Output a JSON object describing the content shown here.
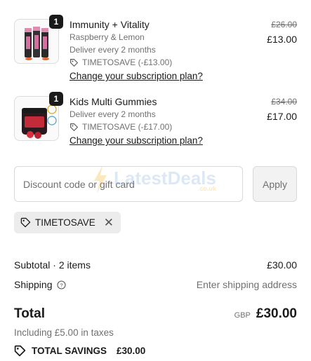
{
  "items": [
    {
      "qty": "1",
      "name": "Immunity + Vitality",
      "variant": "Raspberry & Lemon",
      "delivery": "Deliver every 2 months",
      "discount": "TIMETOSAVE (-£13.00)",
      "change_link": "Change your subscription plan?",
      "original_price": "£26.00",
      "price": "£13.00",
      "image": "product-tubes-image"
    },
    {
      "qty": "1",
      "name": "Kids Multi Gummies",
      "delivery": "Deliver every 2 months",
      "discount": "TIMETOSAVE (-£17.00)",
      "change_link": "Change your subscription plan?",
      "original_price": "£34.00",
      "price": "£17.00",
      "image": "gummies-jar-image"
    }
  ],
  "discount": {
    "placeholder": "Discount code or gift card",
    "apply_label": "Apply",
    "applied_code": "TIMETOSAVE"
  },
  "watermark": {
    "text": "LatestDeals",
    "sub": ".co.uk"
  },
  "summary": {
    "subtotal_label": "Subtotal · 2 items",
    "subtotal_value": "£30.00",
    "shipping_label": "Shipping",
    "shipping_value": "Enter shipping address",
    "total_label": "Total",
    "currency": "GBP",
    "total_value": "£30.00",
    "taxes": "Including £5.00 in taxes",
    "savings_label": "TOTAL SAVINGS",
    "savings_value": "£30.00"
  },
  "colors": {
    "text": "#1a1a1a",
    "muted": "#707070",
    "chip_bg": "#ececec",
    "badge": "#1a1a1a"
  }
}
